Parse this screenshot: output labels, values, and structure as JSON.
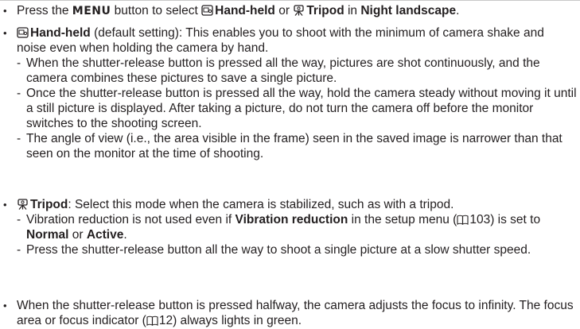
{
  "b1": {
    "pre": "Press the ",
    "menu": "MENU",
    "mid1": " button to select ",
    "handheld": "Hand-held",
    "or": " or ",
    "tripod": "Tripod",
    "in": " in ",
    "night": "Night landscape",
    "end": "."
  },
  "b2": {
    "title": "Hand-held",
    "text": " (default setting): This enables you to shoot with the minimum of camera shake and noise even when holding the camera by hand.",
    "subs": [
      "When the shutter-release button is pressed all the way, pictures are shot continuously, and the camera combines these pictures to save a single picture.",
      "Once the shutter-release button is pressed all the way, hold the camera steady without moving it until a still picture is displayed. After taking a picture, do not turn the camera off before the monitor switches to the shooting screen.",
      "The angle of view (i.e., the area visible in the frame) seen in the saved image is narrower than that seen on the monitor at the time of shooting."
    ]
  },
  "b3": {
    "title": "Tripod",
    "text": ": Select this mode when the camera is stabilized, such as with a tripod.",
    "s1a": "Vibration reduction is not used even if ",
    "s1b": "Vibration reduction",
    "s1c": " in the setup menu (",
    "s1d": "103) is set to ",
    "s1e": "Normal",
    "s1f": " or ",
    "s1g": "Active",
    "s1h": ".",
    "s2": "Press the shutter-release button all the way to shoot a single picture at a slow shutter speed."
  },
  "b4": {
    "a": "When the shutter-release button is pressed halfway, the camera adjusts the focus to infinity. The focus area or focus indicator (",
    "b": "12) always lights in green."
  },
  "bullet": "•",
  "dash": "-"
}
